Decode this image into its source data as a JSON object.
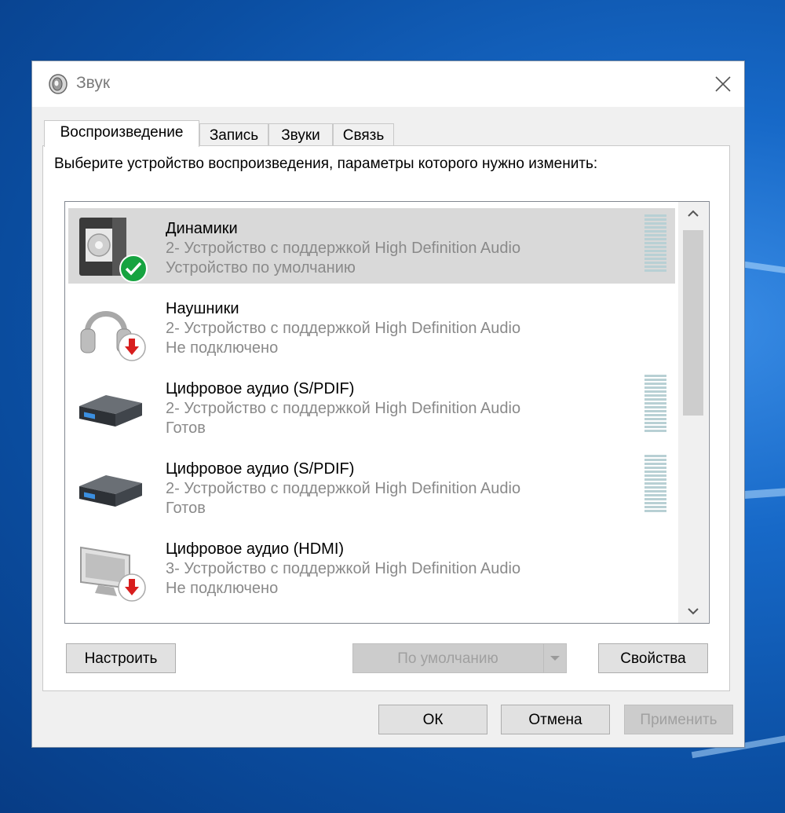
{
  "window": {
    "title": "Звук"
  },
  "tabs": [
    {
      "label": "Воспроизведение",
      "active": true
    },
    {
      "label": "Запись",
      "active": false
    },
    {
      "label": "Звуки",
      "active": false
    },
    {
      "label": "Связь",
      "active": false
    }
  ],
  "instruction": "Выберите устройство воспроизведения, параметры которого нужно изменить:",
  "devices": [
    {
      "name": "Динамики",
      "description": "2- Устройство с поддержкой High Definition Audio",
      "status": "Устройство по умолчанию",
      "icon": "speaker-icon",
      "badge": "default-check-icon",
      "selected": true
    },
    {
      "name": "Наушники",
      "description": "2- Устройство с поддержкой High Definition Audio",
      "status": "Не подключено",
      "icon": "headphones-icon",
      "badge": "disconnected-arrow-icon",
      "selected": false
    },
    {
      "name": "Цифровое аудио (S/PDIF)",
      "description": "2- Устройство с поддержкой High Definition Audio",
      "status": "Готов",
      "icon": "receiver-icon",
      "badge": "",
      "selected": false
    },
    {
      "name": "Цифровое аудио (S/PDIF)",
      "description": "2- Устройство с поддержкой High Definition Audio",
      "status": "Готов",
      "icon": "receiver-icon",
      "badge": "",
      "selected": false
    },
    {
      "name": "Цифровое аудио (HDMI)",
      "description": "3- Устройство с поддержкой High Definition Audio",
      "status": "Не подключено",
      "icon": "monitor-icon",
      "badge": "disconnected-arrow-icon",
      "selected": false
    }
  ],
  "buttons": {
    "configure": "Настроить",
    "set_default": "По умолчанию",
    "properties": "Свойства",
    "ok": "ОК",
    "cancel": "Отмена",
    "apply": "Применить"
  },
  "colors": {
    "accent_check": "#16a340",
    "disconnected_red": "#d81e1e",
    "selection": "#d9d9d9"
  }
}
